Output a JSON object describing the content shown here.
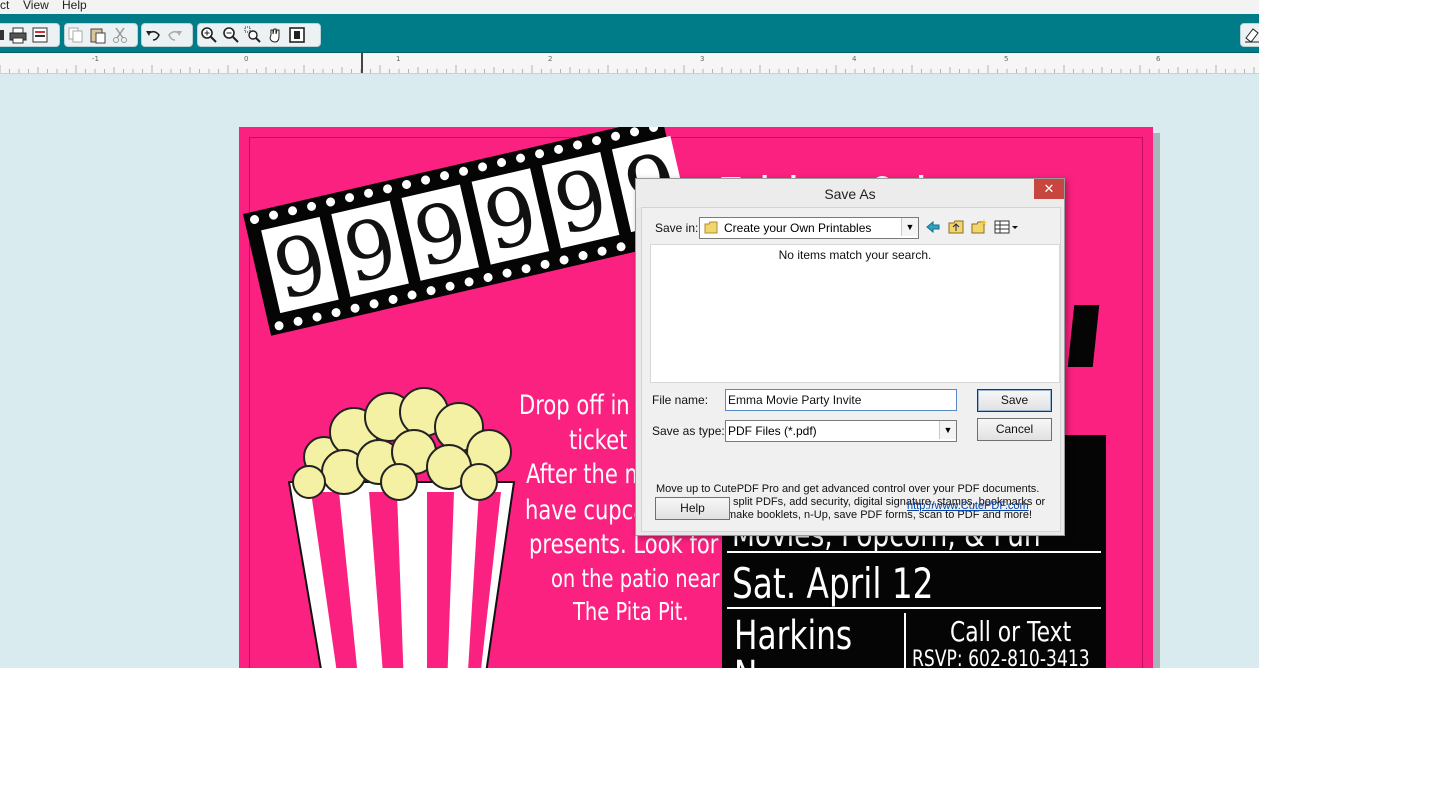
{
  "menu": {
    "items": [
      "ct",
      "View",
      "Help"
    ]
  },
  "toolbar": {
    "icons": [
      "print-icon",
      "print-preview-icon",
      "copy-icon",
      "paste-icon",
      "cut-icon",
      "undo-icon",
      "redo-icon",
      "zoom-in-icon",
      "zoom-out-icon",
      "zoom-area-icon",
      "pan-icon",
      "fit-page-icon",
      "eraser-icon"
    ],
    "accent": "#007b88"
  },
  "ruler": {
    "labels": [
      "-1",
      "0",
      "1",
      "2",
      "3",
      "4",
      "5",
      "6"
    ]
  },
  "document": {
    "background": "#fb2181",
    "film_digits": [
      "9",
      "9",
      "9",
      "9",
      "9",
      "9"
    ],
    "date_partial": "Friday 9th",
    "message_lines": [
      "Drop off in fro",
      "ticket off",
      "After the movi",
      "have cupcakes",
      "presents. Look for us",
      "on the patio near",
      "The Pita Pit."
    ],
    "schedule_line": "Movies, Popcorn, & Fun",
    "event_date": "Sat. April 12",
    "venue": "Harkins",
    "venue_line2": "N",
    "contact_heading": "Call or Text",
    "rsvp": "RSVP: 602-810-3413"
  },
  "dialog": {
    "title": "Save As",
    "close_label": "✕",
    "save_in_label": "Save in:",
    "save_in_value": "Create your Own Printables",
    "empty_message": "No items match your search.",
    "file_name_label": "File name:",
    "file_name_value": "Emma Movie Party Invite",
    "save_as_type_label": "Save as type:",
    "save_as_type_value": "PDF Files (*.pdf)",
    "save_button": "Save",
    "cancel_button": "Cancel",
    "help_button": "Help",
    "promo_text": "Move up to CutePDF Pro and get advanced control over your PDF documents. Easily merge & split PDFs, add security, digital signature, stamps, bookmarks or header/footer, make booklets, n-Up, save PDF forms, scan to PDF and more!",
    "link_text": "http://www.CutePDF.com"
  }
}
